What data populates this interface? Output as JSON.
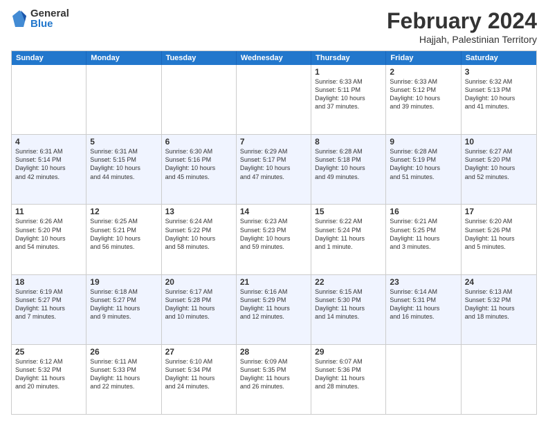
{
  "logo": {
    "general": "General",
    "blue": "Blue"
  },
  "title": "February 2024",
  "subtitle": "Hajjah, Palestinian Territory",
  "header_days": [
    "Sunday",
    "Monday",
    "Tuesday",
    "Wednesday",
    "Thursday",
    "Friday",
    "Saturday"
  ],
  "rows": [
    {
      "alt": false,
      "cells": [
        {
          "day": "",
          "text": ""
        },
        {
          "day": "",
          "text": ""
        },
        {
          "day": "",
          "text": ""
        },
        {
          "day": "",
          "text": ""
        },
        {
          "day": "1",
          "text": "Sunrise: 6:33 AM\nSunset: 5:11 PM\nDaylight: 10 hours\nand 37 minutes."
        },
        {
          "day": "2",
          "text": "Sunrise: 6:33 AM\nSunset: 5:12 PM\nDaylight: 10 hours\nand 39 minutes."
        },
        {
          "day": "3",
          "text": "Sunrise: 6:32 AM\nSunset: 5:13 PM\nDaylight: 10 hours\nand 41 minutes."
        }
      ]
    },
    {
      "alt": true,
      "cells": [
        {
          "day": "4",
          "text": "Sunrise: 6:31 AM\nSunset: 5:14 PM\nDaylight: 10 hours\nand 42 minutes."
        },
        {
          "day": "5",
          "text": "Sunrise: 6:31 AM\nSunset: 5:15 PM\nDaylight: 10 hours\nand 44 minutes."
        },
        {
          "day": "6",
          "text": "Sunrise: 6:30 AM\nSunset: 5:16 PM\nDaylight: 10 hours\nand 45 minutes."
        },
        {
          "day": "7",
          "text": "Sunrise: 6:29 AM\nSunset: 5:17 PM\nDaylight: 10 hours\nand 47 minutes."
        },
        {
          "day": "8",
          "text": "Sunrise: 6:28 AM\nSunset: 5:18 PM\nDaylight: 10 hours\nand 49 minutes."
        },
        {
          "day": "9",
          "text": "Sunrise: 6:28 AM\nSunset: 5:19 PM\nDaylight: 10 hours\nand 51 minutes."
        },
        {
          "day": "10",
          "text": "Sunrise: 6:27 AM\nSunset: 5:20 PM\nDaylight: 10 hours\nand 52 minutes."
        }
      ]
    },
    {
      "alt": false,
      "cells": [
        {
          "day": "11",
          "text": "Sunrise: 6:26 AM\nSunset: 5:20 PM\nDaylight: 10 hours\nand 54 minutes."
        },
        {
          "day": "12",
          "text": "Sunrise: 6:25 AM\nSunset: 5:21 PM\nDaylight: 10 hours\nand 56 minutes."
        },
        {
          "day": "13",
          "text": "Sunrise: 6:24 AM\nSunset: 5:22 PM\nDaylight: 10 hours\nand 58 minutes."
        },
        {
          "day": "14",
          "text": "Sunrise: 6:23 AM\nSunset: 5:23 PM\nDaylight: 10 hours\nand 59 minutes."
        },
        {
          "day": "15",
          "text": "Sunrise: 6:22 AM\nSunset: 5:24 PM\nDaylight: 11 hours\nand 1 minute."
        },
        {
          "day": "16",
          "text": "Sunrise: 6:21 AM\nSunset: 5:25 PM\nDaylight: 11 hours\nand 3 minutes."
        },
        {
          "day": "17",
          "text": "Sunrise: 6:20 AM\nSunset: 5:26 PM\nDaylight: 11 hours\nand 5 minutes."
        }
      ]
    },
    {
      "alt": true,
      "cells": [
        {
          "day": "18",
          "text": "Sunrise: 6:19 AM\nSunset: 5:27 PM\nDaylight: 11 hours\nand 7 minutes."
        },
        {
          "day": "19",
          "text": "Sunrise: 6:18 AM\nSunset: 5:27 PM\nDaylight: 11 hours\nand 9 minutes."
        },
        {
          "day": "20",
          "text": "Sunrise: 6:17 AM\nSunset: 5:28 PM\nDaylight: 11 hours\nand 10 minutes."
        },
        {
          "day": "21",
          "text": "Sunrise: 6:16 AM\nSunset: 5:29 PM\nDaylight: 11 hours\nand 12 minutes."
        },
        {
          "day": "22",
          "text": "Sunrise: 6:15 AM\nSunset: 5:30 PM\nDaylight: 11 hours\nand 14 minutes."
        },
        {
          "day": "23",
          "text": "Sunrise: 6:14 AM\nSunset: 5:31 PM\nDaylight: 11 hours\nand 16 minutes."
        },
        {
          "day": "24",
          "text": "Sunrise: 6:13 AM\nSunset: 5:32 PM\nDaylight: 11 hours\nand 18 minutes."
        }
      ]
    },
    {
      "alt": false,
      "cells": [
        {
          "day": "25",
          "text": "Sunrise: 6:12 AM\nSunset: 5:32 PM\nDaylight: 11 hours\nand 20 minutes."
        },
        {
          "day": "26",
          "text": "Sunrise: 6:11 AM\nSunset: 5:33 PM\nDaylight: 11 hours\nand 22 minutes."
        },
        {
          "day": "27",
          "text": "Sunrise: 6:10 AM\nSunset: 5:34 PM\nDaylight: 11 hours\nand 24 minutes."
        },
        {
          "day": "28",
          "text": "Sunrise: 6:09 AM\nSunset: 5:35 PM\nDaylight: 11 hours\nand 26 minutes."
        },
        {
          "day": "29",
          "text": "Sunrise: 6:07 AM\nSunset: 5:36 PM\nDaylight: 11 hours\nand 28 minutes."
        },
        {
          "day": "",
          "text": ""
        },
        {
          "day": "",
          "text": ""
        }
      ]
    }
  ]
}
